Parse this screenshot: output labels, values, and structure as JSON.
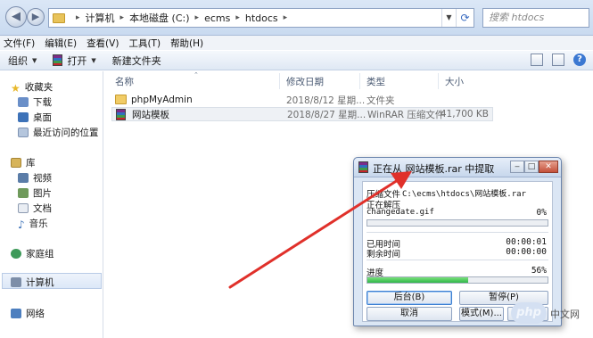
{
  "address_bar": {
    "crumbs": [
      "计算机",
      "本地磁盘 (C:)",
      "ecms",
      "htdocs"
    ],
    "search_placeholder": "搜索 htdocs"
  },
  "menu": [
    "文件(F)",
    "编辑(E)",
    "查看(V)",
    "工具(T)",
    "帮助(H)"
  ],
  "toolbar": {
    "organize": "组织",
    "open": "打开",
    "new_folder": "新建文件夹"
  },
  "nav": {
    "favorites": "收藏夹",
    "favorites_items": [
      "下载",
      "桌面",
      "最近访问的位置"
    ],
    "libraries": "库",
    "library_items": [
      "视频",
      "图片",
      "文档",
      "音乐"
    ],
    "homegroup": "家庭组",
    "computer": "计算机",
    "network": "网络"
  },
  "columns": {
    "name": "名称",
    "date": "修改日期",
    "type": "类型",
    "size": "大小"
  },
  "files": [
    {
      "name": "phpMyAdmin",
      "date": "2018/8/12 星期...",
      "type": "文件夹",
      "size": ""
    },
    {
      "name": "网站模板",
      "date": "2018/8/27 星期...",
      "type": "WinRAR 压缩文件",
      "size": "41,700 KB"
    }
  ],
  "dialog": {
    "title": "正在从 网站模板.rar 中提取",
    "extracting_label": "压缩文件",
    "archive_path": "C:\\ecms\\htdocs\\网站模板.rar",
    "action_label": "正在解压",
    "current_file": "changedate.gif",
    "file_percent": "0%",
    "file_progress": 0.0,
    "elapsed_label": "已用时间",
    "elapsed": "00:00:01",
    "remaining_label": "剩余时间",
    "remaining": "00:00:00",
    "progress_label": "进度",
    "progress_percent": "56%",
    "progress": 0.56,
    "buttons": {
      "background": "后台(B)",
      "pause": "暂停(P)",
      "cancel": "取消",
      "mode": "模式(M)...",
      "help": "帮助"
    }
  },
  "watermark": {
    "badge": "php",
    "text": "中文网"
  },
  "colors": {
    "arrow": "#e0302a",
    "progress": "#2fb64a"
  }
}
